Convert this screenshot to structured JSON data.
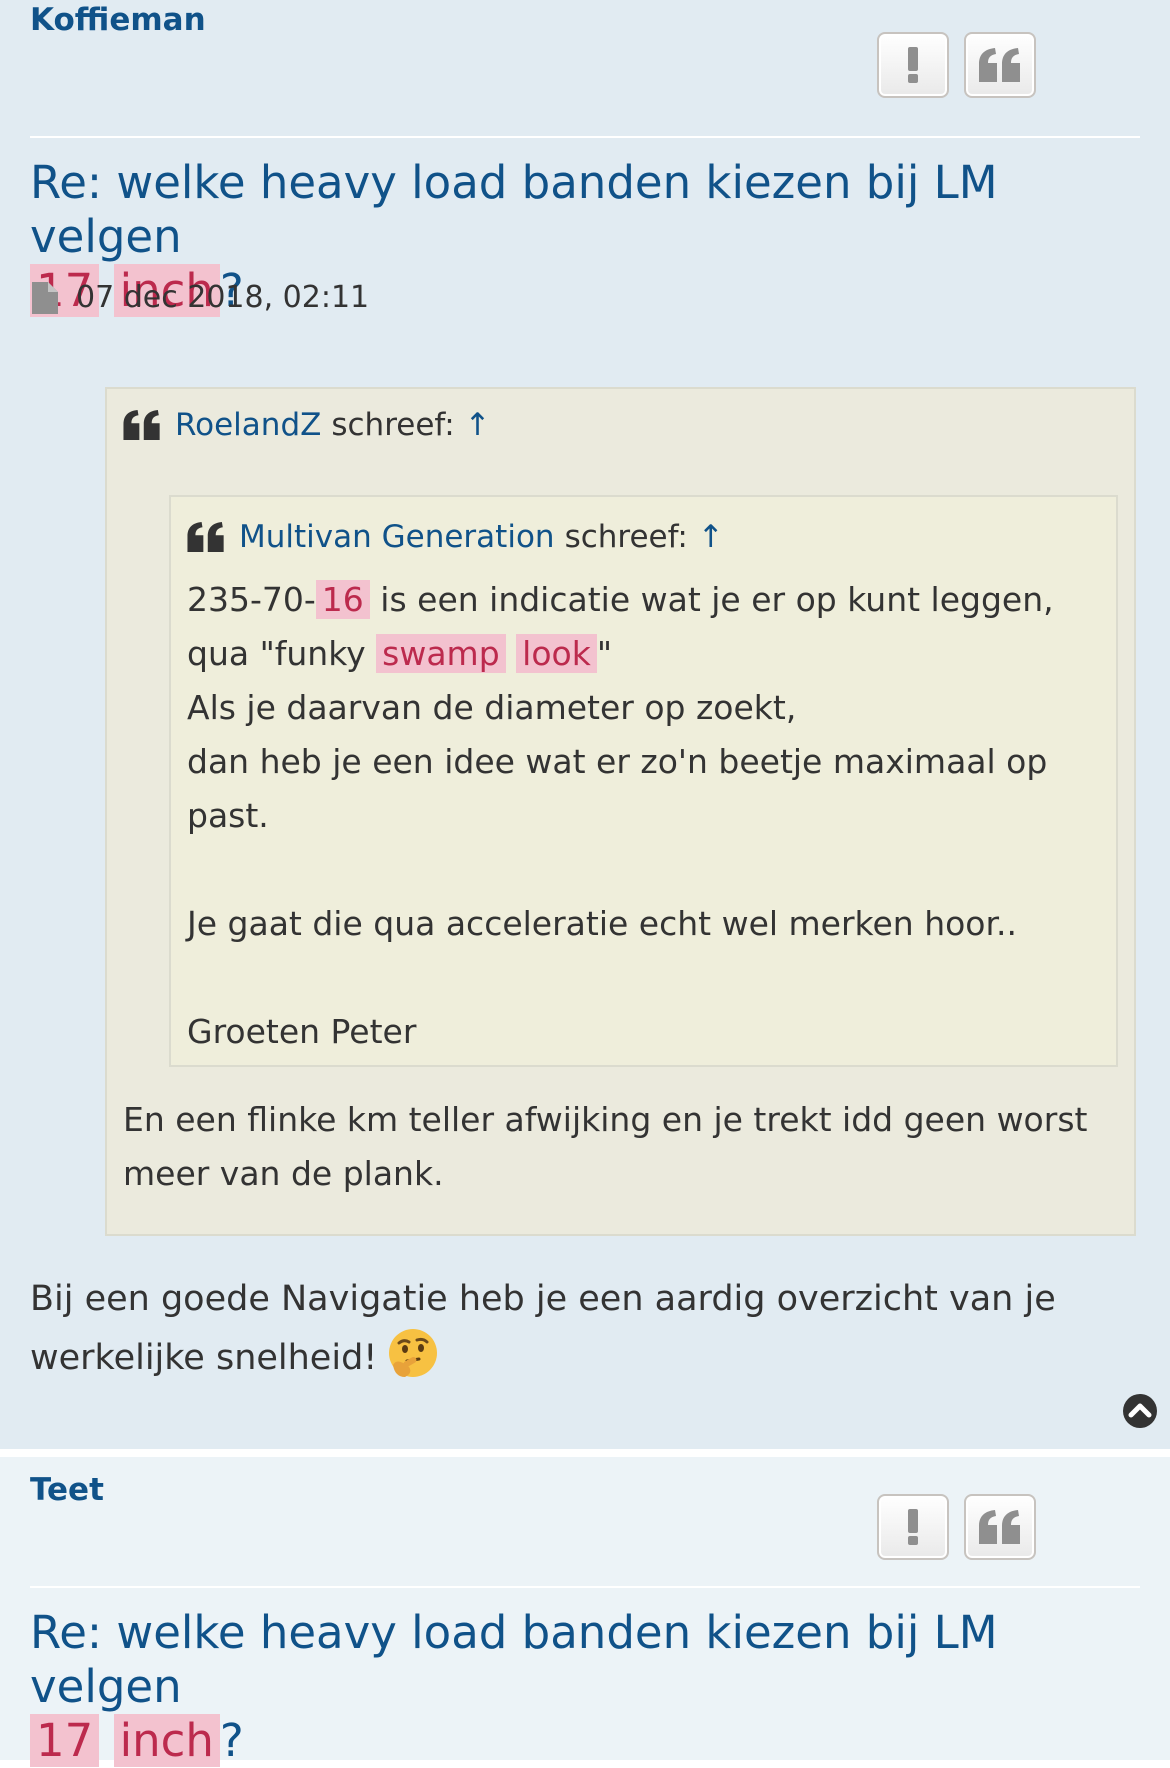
{
  "posts": [
    {
      "author": "Koffieman",
      "title": {
        "prefix": "Re: welke heavy load banden kiezen bij LM velgen",
        "hl1": "17",
        "hl2": "inch",
        "suffix": "?"
      },
      "date": "07 dec 2018, 02:11",
      "quote": {
        "author": "RoelandZ",
        "wrote": "schreef:",
        "up": "↑",
        "nested": {
          "author": "Multivan Generation",
          "wrote": "schreef:",
          "up": "↑",
          "line1_a": "235-70-",
          "line1_hl": "16",
          "line1_b": " is een indicatie wat je er op kunt leggen,",
          "line2_a": "qua \"funky ",
          "line2_hl1": "swamp",
          "line2_hl2": "look",
          "line2_b": "\"",
          "line3": "Als je daarvan de diameter op zoekt,",
          "line4": "dan heb je een idee wat er zo'n beetje maximaal op past.",
          "line5": "Je gaat die qua acceleratie echt wel merken hoor..",
          "line6": "Groeten Peter"
        },
        "text": "En een flinke km teller afwijking en je trekt idd geen worst meer van de plank."
      },
      "body": "Bij een goede Navigatie heb je een aardig overzicht van je werkelijke snelheid!",
      "emoji": "thinking-face-emoji"
    },
    {
      "author": "Teet",
      "title": {
        "prefix": "Re: welke heavy load banden kiezen bij LM velgen",
        "hl1": "17",
        "hl2": "inch",
        "suffix": "?"
      }
    }
  ],
  "icons": {
    "report": "exclamation-icon",
    "quote": "quote-icon",
    "post": "document-icon",
    "top": "back-to-top-icon"
  },
  "colors": {
    "post_bg_1": "#e1ebf2",
    "post_bg_2": "#ecf3f7",
    "link": "#105289",
    "highlight_bg": "#f3c2cf",
    "highlight_text": "#bc2a4d",
    "quote_bg": "#ebeadd",
    "nested_quote_bg": "#efeedb"
  }
}
